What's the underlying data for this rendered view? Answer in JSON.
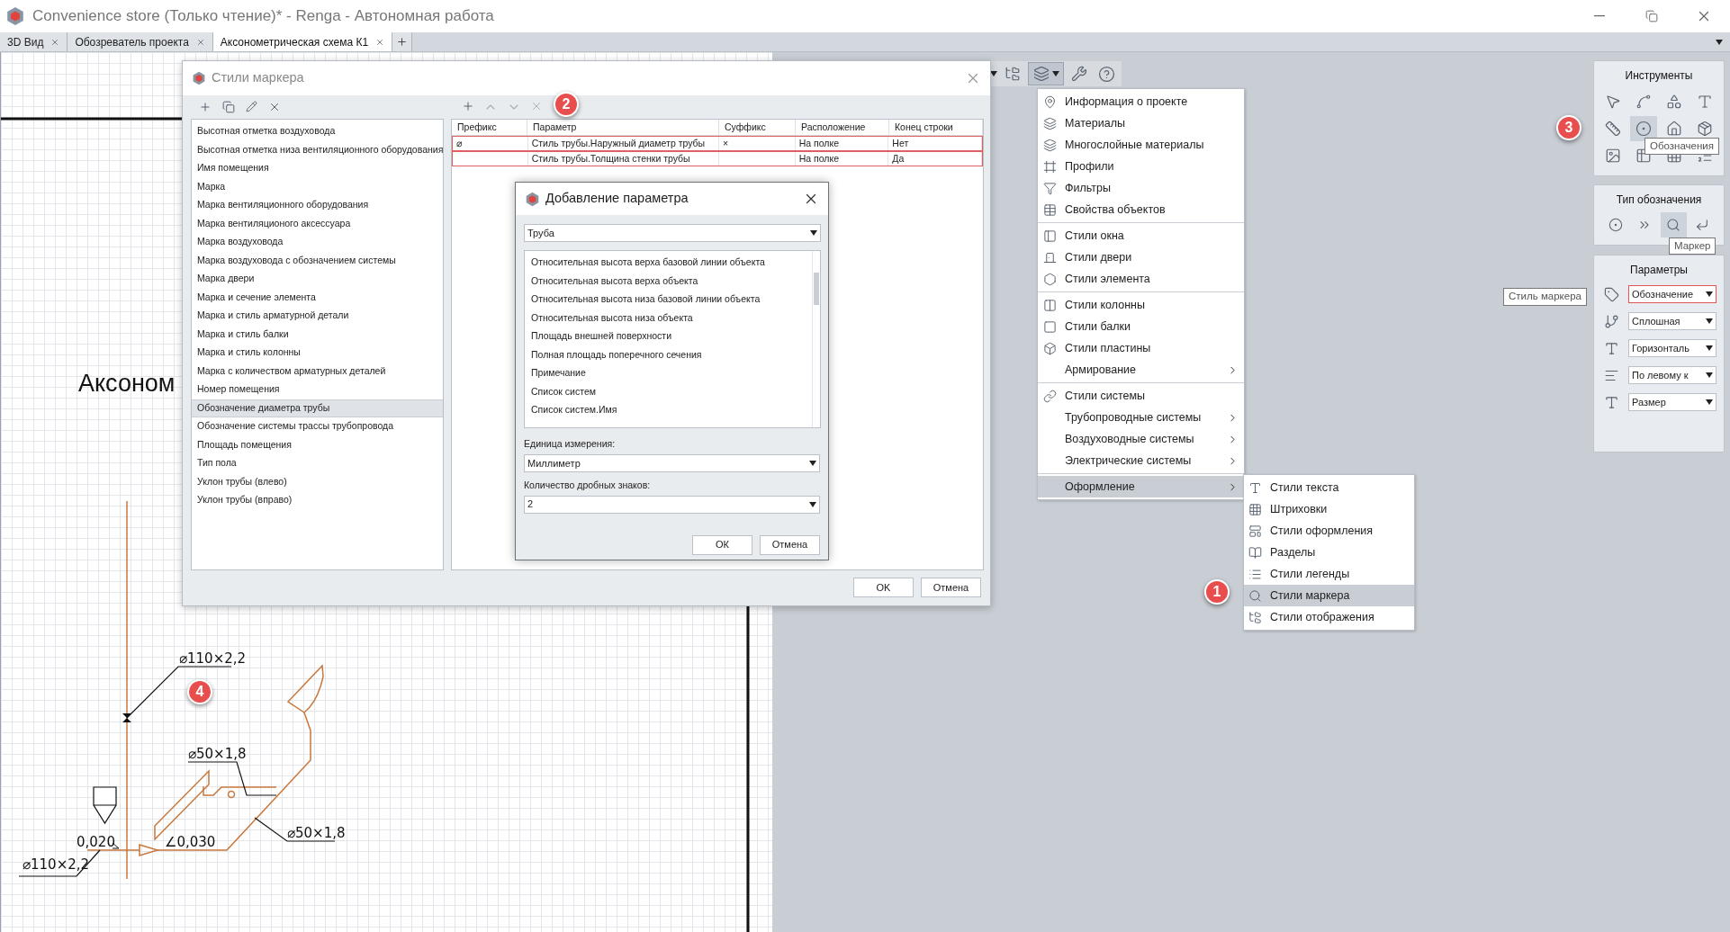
{
  "window": {
    "title": "Convenience store (Только чтение)* - Renga - Автономная работа"
  },
  "tabs": [
    {
      "label": "3D Вид",
      "selected": false
    },
    {
      "label": "Обозреватель проекта",
      "selected": false
    },
    {
      "label": "Аксонометрическая схема К1",
      "selected": true
    }
  ],
  "drawing": {
    "heading": "Аксоном",
    "annotations": [
      "⌀110×2,2",
      "⌀50×1,8",
      "⌀50×1,8",
      "0,020",
      "∠0,030",
      "⌀110×2,2"
    ]
  },
  "marker_styles_dialog": {
    "title": "Стили маркера",
    "styles": [
      {
        "label": "Высотная отметка воздуховода",
        "selected": false
      },
      {
        "label": "Высотная отметка низа вентиляционного оборудования",
        "selected": false
      },
      {
        "label": "Имя помещения",
        "selected": false
      },
      {
        "label": "Марка",
        "selected": false
      },
      {
        "label": "Марка вентиляционного оборудования",
        "selected": false
      },
      {
        "label": "Марка вентиляционого аксессуара",
        "selected": false
      },
      {
        "label": "Марка воздуховода",
        "selected": false
      },
      {
        "label": "Марка воздуховода с обозначением  системы",
        "selected": false
      },
      {
        "label": "Марка двери",
        "selected": false
      },
      {
        "label": "Марка и сечение элемента",
        "selected": false
      },
      {
        "label": "Марка и стиль арматурной детали",
        "selected": false
      },
      {
        "label": "Марка и стиль балки",
        "selected": false
      },
      {
        "label": "Марка и стиль колонны",
        "selected": false
      },
      {
        "label": "Марка с количеством арматурных деталей",
        "selected": false
      },
      {
        "label": "Номер помещения",
        "selected": false
      },
      {
        "label": "Обозначение диаметра трубы",
        "selected": true
      },
      {
        "label": "Обозначение системы трассы трубопровода",
        "selected": false
      },
      {
        "label": "Площадь помещения",
        "selected": false
      },
      {
        "label": "Тип пола",
        "selected": false
      },
      {
        "label": "Уклон трубы (влево)",
        "selected": false
      },
      {
        "label": "Уклон трубы (вправо)",
        "selected": false
      }
    ],
    "columns": [
      "Префикс",
      "Параметр",
      "Суффикс",
      "Расположение",
      "Конец строки"
    ],
    "rows": [
      {
        "prefix": "⌀",
        "parameter": "Стиль трубы.Наружный диаметр трубы",
        "suffix": "×",
        "placement": "На полке",
        "line_end": "Нет",
        "flagged": true
      },
      {
        "parameter": "Стиль трубы.Толщина стенки трубы",
        "placement": "На полке",
        "line_end": "Да",
        "flagged": true
      }
    ],
    "buttons": [
      "OK",
      "Отмена"
    ]
  },
  "add_parameter_dialog": {
    "title": "Добавление параметра",
    "category": "Труба",
    "parameters": [
      "Относительная высота верха базовой линии объекта",
      "Относительная высота верха объекта",
      "Относительная высота низа базовой линии объекта",
      "Относительная высота низа объекта",
      "Площадь внешней поверхности",
      "Полная площадь поперечного сечения",
      "Примечание",
      "Список систем",
      "Список систем.Имя"
    ],
    "unit_label": "Единица измерения:",
    "unit": "Миллиметр",
    "decimals_label": "Количество дробных знаков:",
    "decimals": "2",
    "buttons": [
      "ОК",
      "Отмена"
    ]
  },
  "menu": {
    "groups": [
      [
        {
          "label": "Информация о проекте",
          "has_submenu": false,
          "highlighted": false
        },
        {
          "label": "Материалы",
          "has_submenu": false,
          "highlighted": false
        },
        {
          "label": "Многослойные материалы",
          "has_submenu": false,
          "highlighted": false
        },
        {
          "label": "Профили",
          "has_submenu": false,
          "highlighted": false
        },
        {
          "label": "Фильтры",
          "has_submenu": false,
          "highlighted": false
        },
        {
          "label": "Свойства объектов",
          "has_submenu": false,
          "highlighted": false
        }
      ],
      [
        {
          "label": "Стили окна",
          "has_submenu": false,
          "highlighted": false
        },
        {
          "label": "Стили двери",
          "has_submenu": false,
          "highlighted": false
        },
        {
          "label": "Стили элемента",
          "has_submenu": false,
          "highlighted": false
        }
      ],
      [
        {
          "label": "Стили колонны",
          "has_submenu": false,
          "highlighted": false
        },
        {
          "label": "Стили балки",
          "has_submenu": false,
          "highlighted": false
        },
        {
          "label": "Стили пластины",
          "has_submenu": false,
          "highlighted": false
        },
        {
          "label": "Армирование",
          "has_submenu": true,
          "highlighted": false
        }
      ],
      [
        {
          "label": "Стили системы",
          "has_submenu": false,
          "highlighted": false
        },
        {
          "label": "Трубопроводные системы",
          "has_submenu": true,
          "highlighted": false
        },
        {
          "label": "Воздуховодные системы",
          "has_submenu": true,
          "highlighted": false
        },
        {
          "label": "Электрические системы",
          "has_submenu": true,
          "highlighted": false
        }
      ],
      [
        {
          "label": "Оформление",
          "has_submenu": true,
          "highlighted": true
        }
      ]
    ]
  },
  "submenu": {
    "items": [
      {
        "label": "Стили текста",
        "selected": false
      },
      {
        "label": "Штриховки",
        "selected": false
      },
      {
        "label": "Стили оформления",
        "selected": false
      },
      {
        "label": "Разделы",
        "selected": false
      },
      {
        "label": "Стили легенды",
        "selected": false
      },
      {
        "label": "Стили маркера",
        "selected": true
      },
      {
        "label": "Стили отображения",
        "selected": false
      }
    ]
  },
  "tools_panel": {
    "title": "Инструменты",
    "tools": [
      {
        "selected": false
      },
      {
        "selected": false
      },
      {
        "selected": false
      },
      {
        "selected": false
      },
      {
        "selected": false
      },
      {
        "selected": true
      },
      {
        "selected": false
      },
      {
        "selected": false
      },
      {
        "selected": false
      },
      {
        "selected": false
      },
      {
        "selected": false
      },
      {
        "selected": false
      }
    ],
    "tooltip": "Обозначения"
  },
  "type_panel": {
    "title": "Тип обозначения",
    "types": [
      {
        "selected": false
      },
      {
        "selected": false
      },
      {
        "selected": true
      },
      {
        "selected": false
      }
    ],
    "tooltip": "Маркер"
  },
  "params_panel": {
    "title": "Параметры",
    "fields": [
      {
        "value": "Обозначение",
        "highlighted": true
      },
      {
        "value": "Сплошная",
        "highlighted": false
      },
      {
        "value": "Горизонталь",
        "highlighted": false
      },
      {
        "value": "По левому к",
        "highlighted": false
      },
      {
        "value": "Размер",
        "highlighted": false
      }
    ],
    "tooltip": "Стиль маркера"
  },
  "badges": [
    "1",
    "2",
    "3",
    "4"
  ]
}
